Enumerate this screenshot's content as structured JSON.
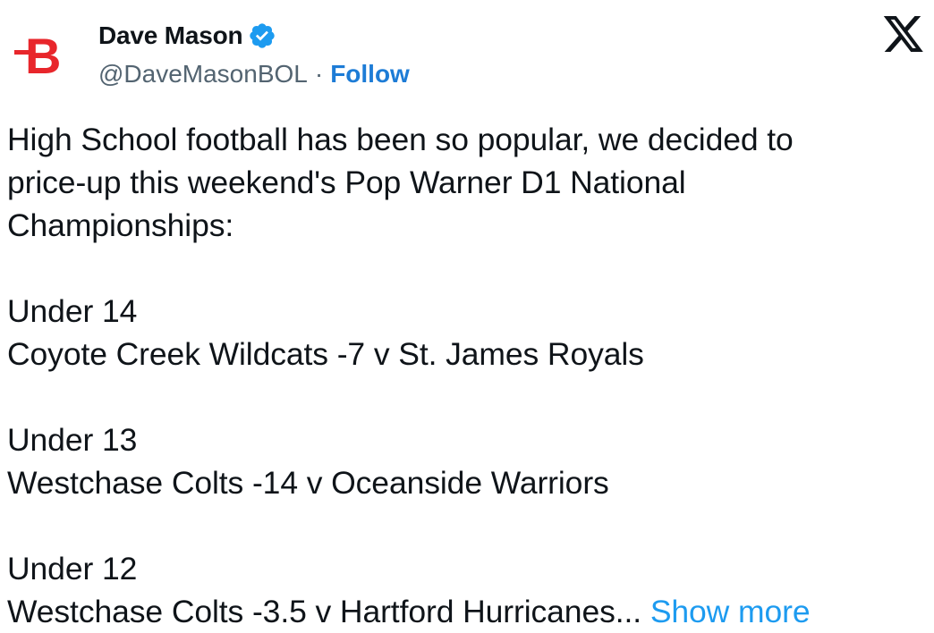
{
  "author": {
    "display_name": "Dave Mason",
    "handle": "@DaveMasonBOL",
    "separator": "·",
    "follow_label": "Follow",
    "verified": true,
    "avatar_letter": "B",
    "avatar_color": "#e8262b"
  },
  "icons": {
    "verified": "verified-badge-icon",
    "platform": "x-logo-icon"
  },
  "colors": {
    "link": "#1d7cd6",
    "show_more": "#1d9bf0",
    "verified": "#1d9bf0",
    "text": "#0f1419",
    "muted": "#536471"
  },
  "tweet": {
    "intro_lines": [
      "High School football has been so popular, we decided to",
      "price-up this weekend's Pop Warner D1 National",
      "Championships:"
    ],
    "games": [
      {
        "division": "Under 14",
        "matchup": "Coyote Creek Wildcats -7 v St. James Royals"
      },
      {
        "division": "Under 13",
        "matchup": "Westchase Colts -14 v Oceanside Warriors"
      },
      {
        "division": "Under 12",
        "matchup": "Westchase Colts -3.5 v Hartford Hurricanes..."
      }
    ],
    "show_more_label": "Show more"
  }
}
